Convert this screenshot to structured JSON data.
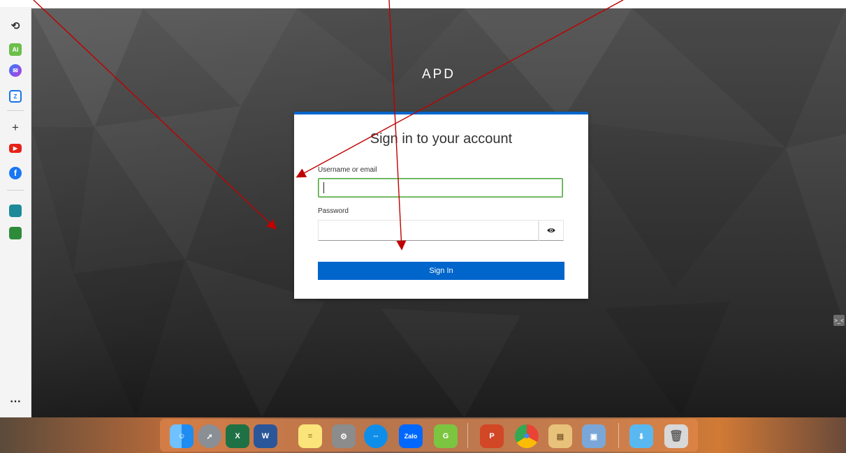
{
  "page": {
    "app_title": "APD"
  },
  "login": {
    "heading": "Sign in to your account",
    "username_label": "Username or email",
    "username_value": "",
    "password_label": "Password",
    "password_value": "",
    "submit_label": "Sign In"
  },
  "sidebar": {
    "items": [
      {
        "name": "history-icon",
        "glyph": "⟲"
      },
      {
        "name": "ai-icon",
        "glyph": "AI"
      },
      {
        "name": "messenger-icon",
        "glyph": "✉"
      },
      {
        "name": "zalo-icon",
        "glyph": "Z"
      },
      {
        "name": "add-icon",
        "glyph": "+"
      },
      {
        "name": "youtube-icon",
        "glyph": "▶"
      },
      {
        "name": "facebook-icon",
        "glyph": "f"
      },
      {
        "name": "app-icon-1",
        "glyph": ""
      },
      {
        "name": "app-icon-2",
        "glyph": ""
      }
    ],
    "more_glyph": "⋯"
  },
  "extension_badge": ">_<",
  "dock": {
    "apps": [
      {
        "name": "finder-icon",
        "glyph": "☺"
      },
      {
        "name": "launchpad-icon",
        "glyph": "➚"
      },
      {
        "name": "excel-icon",
        "glyph": "X"
      },
      {
        "name": "word-icon",
        "glyph": "W"
      },
      {
        "name": "notes-icon",
        "glyph": "≡"
      },
      {
        "name": "system-preferences-icon",
        "glyph": "⚙"
      },
      {
        "name": "teamviewer-icon",
        "glyph": "⇔"
      },
      {
        "name": "zalo-dock-icon",
        "glyph": "Zalo"
      },
      {
        "name": "coccoc-icon",
        "glyph": "G"
      },
      {
        "name": "powerpoint-icon",
        "glyph": "P"
      },
      {
        "name": "chrome-icon",
        "glyph": "●"
      },
      {
        "name": "archive-icon",
        "glyph": "▤"
      },
      {
        "name": "preview-icon",
        "glyph": "▣"
      },
      {
        "name": "downloads-icon",
        "glyph": "⬇"
      },
      {
        "name": "trash-icon",
        "glyph": "🗑"
      }
    ]
  },
  "colors": {
    "accent": "#0066cc",
    "focus_border": "#5ba24d",
    "annotation_arrow": "#c00000"
  }
}
